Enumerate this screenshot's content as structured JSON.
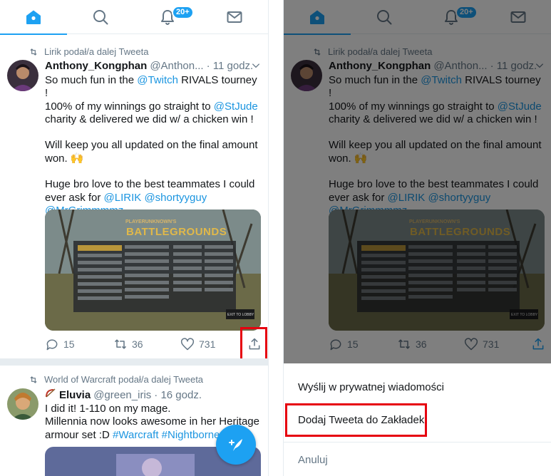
{
  "nav": {
    "badge": "20+"
  },
  "tweet1": {
    "retweeted_by": "Lirik podał/a dalej Tweeta",
    "name": "Anthony_Kongphan",
    "handle": "@Anthon...",
    "time": "· 11 godz.",
    "lines": [
      [
        "So much fun in the ",
        "@Twitch",
        " RIVALS tourney !"
      ],
      [
        "100% of my winnings go straight to ",
        "@StJude"
      ],
      [
        "charity & delivered we did w/ a chicken win !"
      ],
      [],
      [
        "Will keep you all updated on the final amount"
      ],
      [
        "won. 🙌"
      ],
      [],
      [
        "Huge bro love to the best teammates I could"
      ],
      [
        "ever ask for ",
        "@LIRIK",
        " ",
        "@shortyyguy"
      ],
      [
        "@MrGrimmmmz"
      ]
    ],
    "media_title_small": "PLAYERUNKNOWN'S",
    "media_title": "BATTLEGROUNDS",
    "media_button": "EXIT TO LOBBY",
    "replies": "15",
    "retweets": "36",
    "likes": "731"
  },
  "tweet2": {
    "retweeted_by": "World of Warcraft podał/a dalej Tweeta",
    "name": "Eluvia",
    "handle": "@green_iris",
    "time": "· 16 godz.",
    "line1": "I did it! 1-110 on my mage.",
    "line2": "Millennia now looks awesome in her Heritage",
    "line3_text": "armour set :D ",
    "line3_tag1": "#Warcraft",
    "line3_tag2": "#Nightborne"
  },
  "share_sheet": {
    "item1": "Wyślij w prywatnej wiadomości",
    "item2": "Dodaj Tweeta do Zakładek",
    "item3": "Anuluj"
  },
  "colors": {
    "accent": "#1da1f2",
    "link": "#1b95e0",
    "highlight": "#e6000f"
  }
}
